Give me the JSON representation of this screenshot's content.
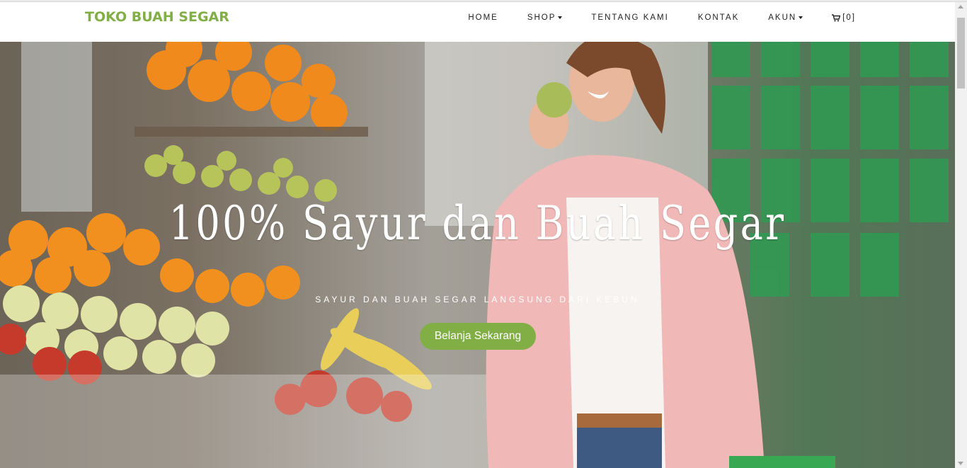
{
  "brand": {
    "name": "TOKO BUAH SEGAR",
    "color": "#82ae46"
  },
  "nav": {
    "items": [
      {
        "label": "HOME",
        "dropdown": false
      },
      {
        "label": "SHOP",
        "dropdown": true
      },
      {
        "label": "TENTANG KAMI",
        "dropdown": false
      },
      {
        "label": "KONTAK",
        "dropdown": false
      },
      {
        "label": "AKUN",
        "dropdown": true
      }
    ],
    "cart": {
      "icon": "cart-icon",
      "label": "[0]"
    }
  },
  "hero": {
    "title": "100% Sayur dan Buah Segar",
    "subtitle": "SAYUR DAN BUAH SEGAR LANGSUNG DARI KEBUN",
    "button_label": "Belanja Sekarang",
    "image": "woman-eating-apple-in-fruit-store"
  }
}
